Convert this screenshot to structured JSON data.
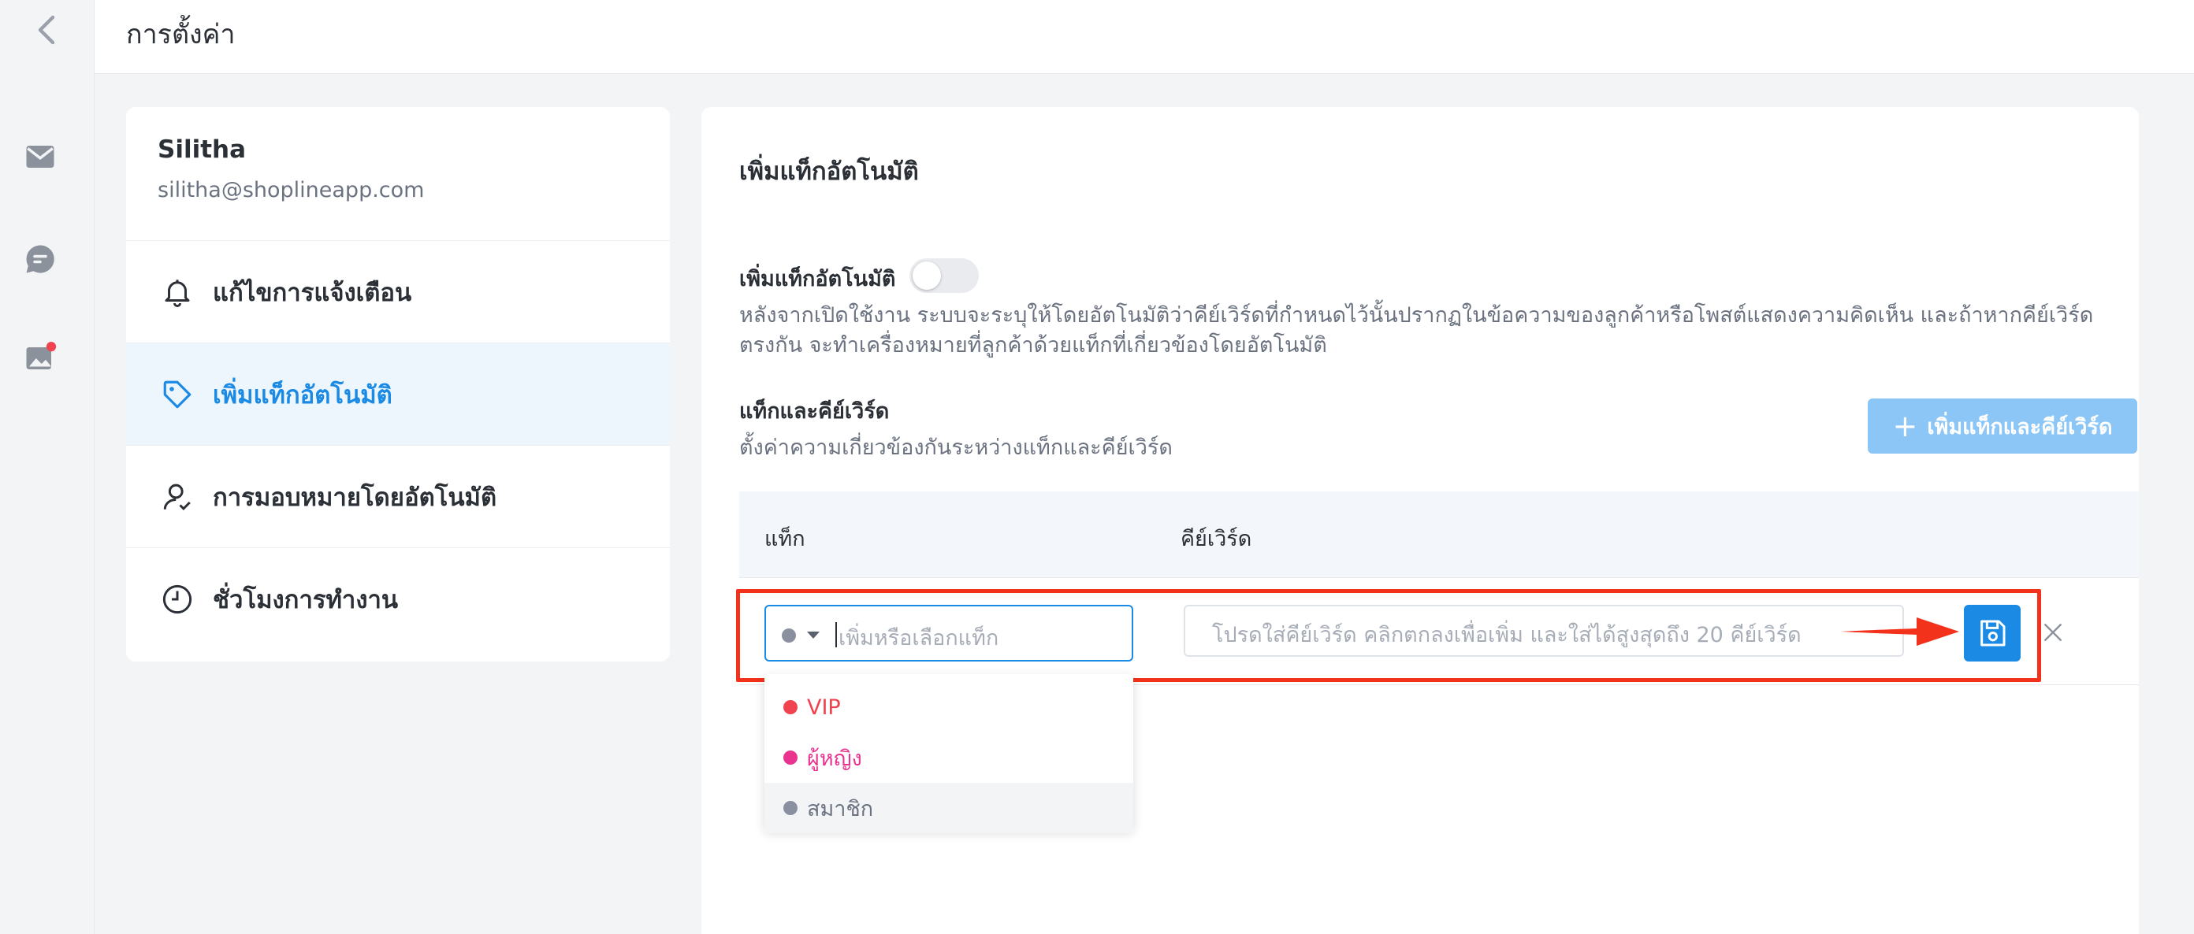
{
  "header": {
    "title": "การตั้งค่า"
  },
  "account": {
    "name": "Silitha",
    "email": "silitha@shoplineapp.com"
  },
  "menu": {
    "items": [
      {
        "label": "แก้ไขการแจ้งเตือน",
        "icon": "bell-icon"
      },
      {
        "label": "เพิ่มแท็กอัตโนมัติ",
        "icon": "tag-icon",
        "active": true
      },
      {
        "label": "การมอบหมายโดยอัตโนมัติ",
        "icon": "user-check-icon"
      },
      {
        "label": "ชั่วโมงการทำงาน",
        "icon": "clock-icon"
      }
    ]
  },
  "panel": {
    "title": "เพิ่มแท็กอัตโนมัติ",
    "toggle_label": "เพิ่มแท็กอัตโนมัติ",
    "toggle_on": false,
    "description": "หลังจากเปิดใช้งาน ระบบจะระบุให้โดยอัตโนมัติว่าคีย์เวิร์ดที่กำหนดไว้นั้นปรากฏในข้อความของลูกค้าหรือโพสต์แสดงความคิดเห็น และถ้าหากคีย์เวิร์ดตรงกัน จะทำเครื่องหมายที่ลูกค้าด้วยแท็กที่เกี่ยวข้องโดยอัตโนมัติ",
    "kw_title": "แท็กและคีย์เวิร์ด",
    "kw_subtitle": "ตั้งค่าความเกี่ยวข้องกันระหว่างแท็กและคีย์เวิร์ด",
    "add_button": "เพิ่มแท็กและคีย์เวิร์ด"
  },
  "table": {
    "col_tag": "แท็ก",
    "col_keyword": "คีย์เวิร์ด",
    "tag_placeholder": "เพิ่มหรือเลือกแท็ก",
    "keyword_placeholder": "โปรดใส่คีย์เวิร์ด คลิกตกลงเพื่อเพิ่ม และใส่ได้สูงสุดถึง 20 คีย์เวิร์ด"
  },
  "dropdown": {
    "options": [
      {
        "label": "VIP",
        "color": "#f0434f"
      },
      {
        "label": "ผู้หญิง",
        "color": "#e8338f"
      },
      {
        "label": "สมาชิก",
        "color": "#8a90a0"
      }
    ]
  },
  "colors": {
    "accent": "#1a8ae5",
    "highlight": "#f2321b",
    "notification": "#f0434f"
  }
}
